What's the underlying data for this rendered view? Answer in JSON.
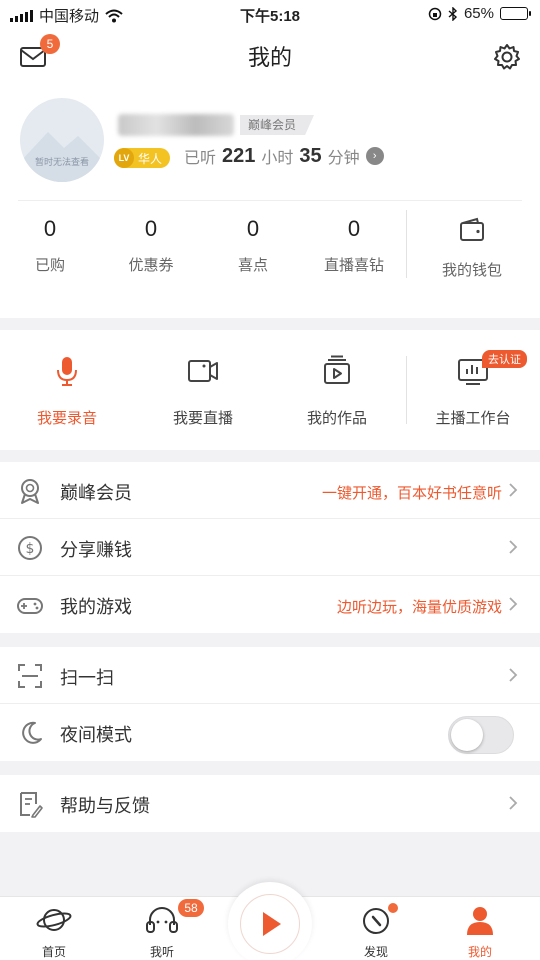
{
  "status_bar": {
    "carrier": "中国移动",
    "time": "下午5:18",
    "battery": "65%",
    "battery_level": 0.65
  },
  "header": {
    "title": "我的",
    "mail_badge": "5"
  },
  "profile": {
    "vip_tag": "巅峰会员",
    "avatar_text": "暂时无法查看",
    "level_badge": "LV",
    "level_name": "华人",
    "listen_prefix": "已听",
    "hours": "221",
    "hours_unit": "小时",
    "minutes": "35",
    "minutes_unit": "分钟"
  },
  "stats": [
    {
      "value": "0",
      "label": "已购"
    },
    {
      "value": "0",
      "label": "优惠券"
    },
    {
      "value": "0",
      "label": "喜点"
    },
    {
      "value": "0",
      "label": "直播喜钻"
    }
  ],
  "wallet": {
    "label": "我的钱包"
  },
  "actions": [
    {
      "label": "我要录音"
    },
    {
      "label": "我要直播"
    },
    {
      "label": "我的作品"
    },
    {
      "label": "主播工作台",
      "badge": "去认证"
    }
  ],
  "menu": {
    "vip": {
      "label": "巅峰会员",
      "extra": "一键开通，百本好书任意听"
    },
    "share": {
      "label": "分享赚钱"
    },
    "games": {
      "label": "我的游戏",
      "extra": "边听边玩，海量优质游戏"
    },
    "scan": {
      "label": "扫一扫"
    },
    "night": {
      "label": "夜间模式",
      "enabled": false
    },
    "help": {
      "label": "帮助与反馈"
    }
  },
  "tabbar": {
    "home": "首页",
    "listen": "我听",
    "listen_badge": "58",
    "discover": "发现",
    "mine": "我的"
  },
  "colors": {
    "accent": "#ee5a30",
    "badge": "#f06a3c",
    "level": "#f3c223"
  }
}
